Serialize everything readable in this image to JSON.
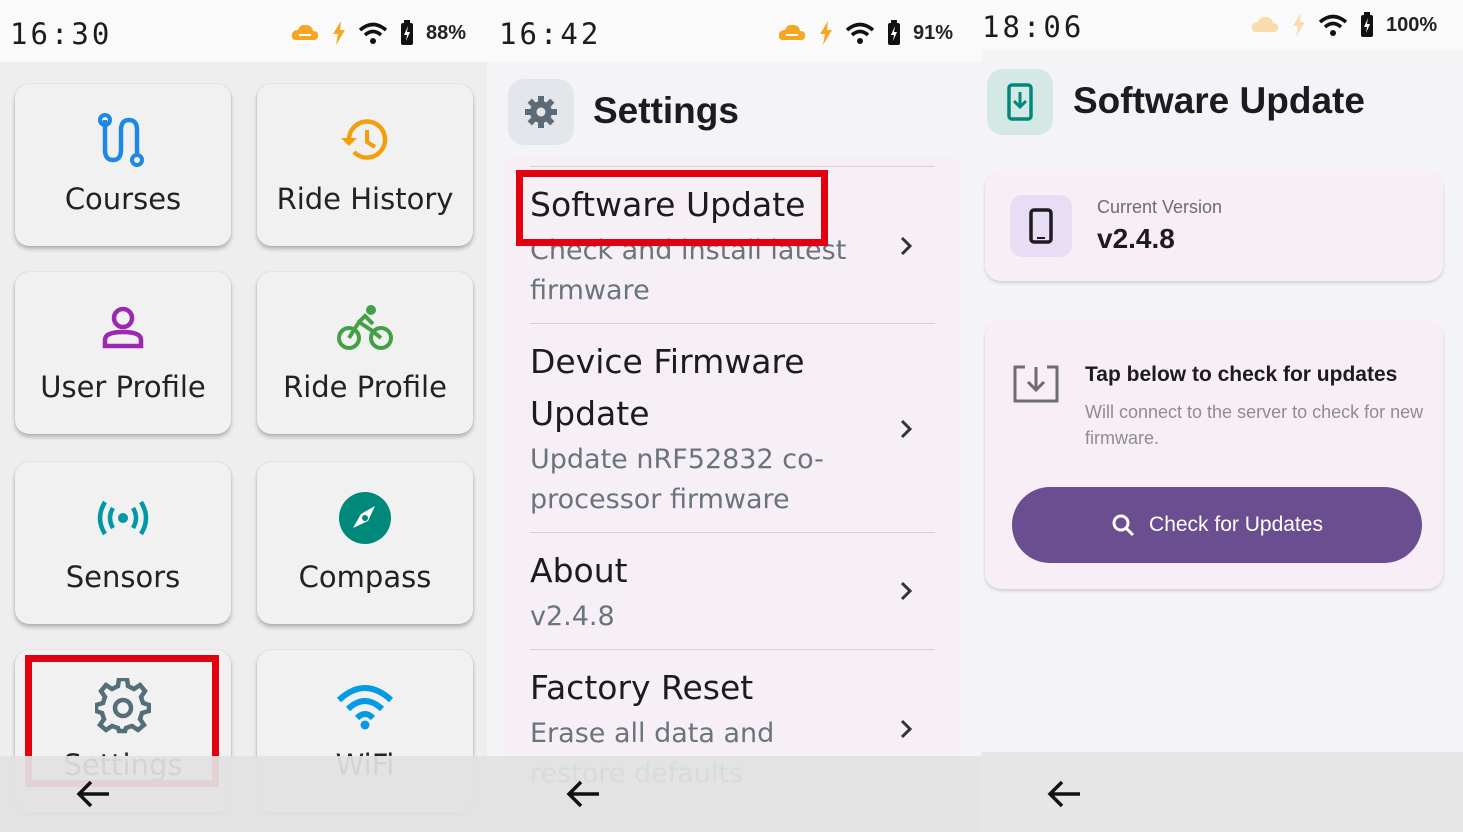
{
  "panel1": {
    "status": {
      "time": "16:30",
      "battery": "88%"
    },
    "tiles": [
      {
        "label": "Courses",
        "icon": "route-icon",
        "color": "#1e88e5"
      },
      {
        "label": "Ride History",
        "icon": "history-icon",
        "color": "#f59e0b"
      },
      {
        "label": "User Profile",
        "icon": "person-icon",
        "color": "#9c27b0"
      },
      {
        "label": "Ride Profile",
        "icon": "bicycle-icon",
        "color": "#43a047"
      },
      {
        "label": "Sensors",
        "icon": "sensors-icon",
        "color": "#0097a7"
      },
      {
        "label": "Compass",
        "icon": "compass-icon",
        "color": "#00897b"
      },
      {
        "label": "Settings",
        "icon": "gear-icon",
        "color": "#546e7a"
      },
      {
        "label": "WiFi",
        "icon": "wifi-icon",
        "color": "#039be5"
      }
    ]
  },
  "panel2": {
    "status": {
      "time": "16:42",
      "battery": "91%"
    },
    "title": "Settings",
    "items": [
      {
        "title": "Software Update",
        "subtitle": "Check and install latest firmware"
      },
      {
        "title": "Device Firmware Update",
        "subtitle": "Update nRF52832 co-processor firmware"
      },
      {
        "title": "About",
        "subtitle": "v2.4.8"
      },
      {
        "title": "Factory Reset",
        "subtitle": "Erase all data and restore defaults"
      }
    ]
  },
  "panel3": {
    "status": {
      "time": "18:06",
      "battery": "100%"
    },
    "title": "Software Update",
    "current_version_label": "Current Version",
    "current_version": "v2.4.8",
    "update_title": "Tap below to check for updates",
    "update_subtitle": "Will connect to the server to check for new firmware.",
    "check_button": "Check for Updates"
  },
  "colors": {
    "highlight": "#e3000f",
    "primary_button": "#6a4e8f",
    "card_bg": "#f8eff6"
  }
}
